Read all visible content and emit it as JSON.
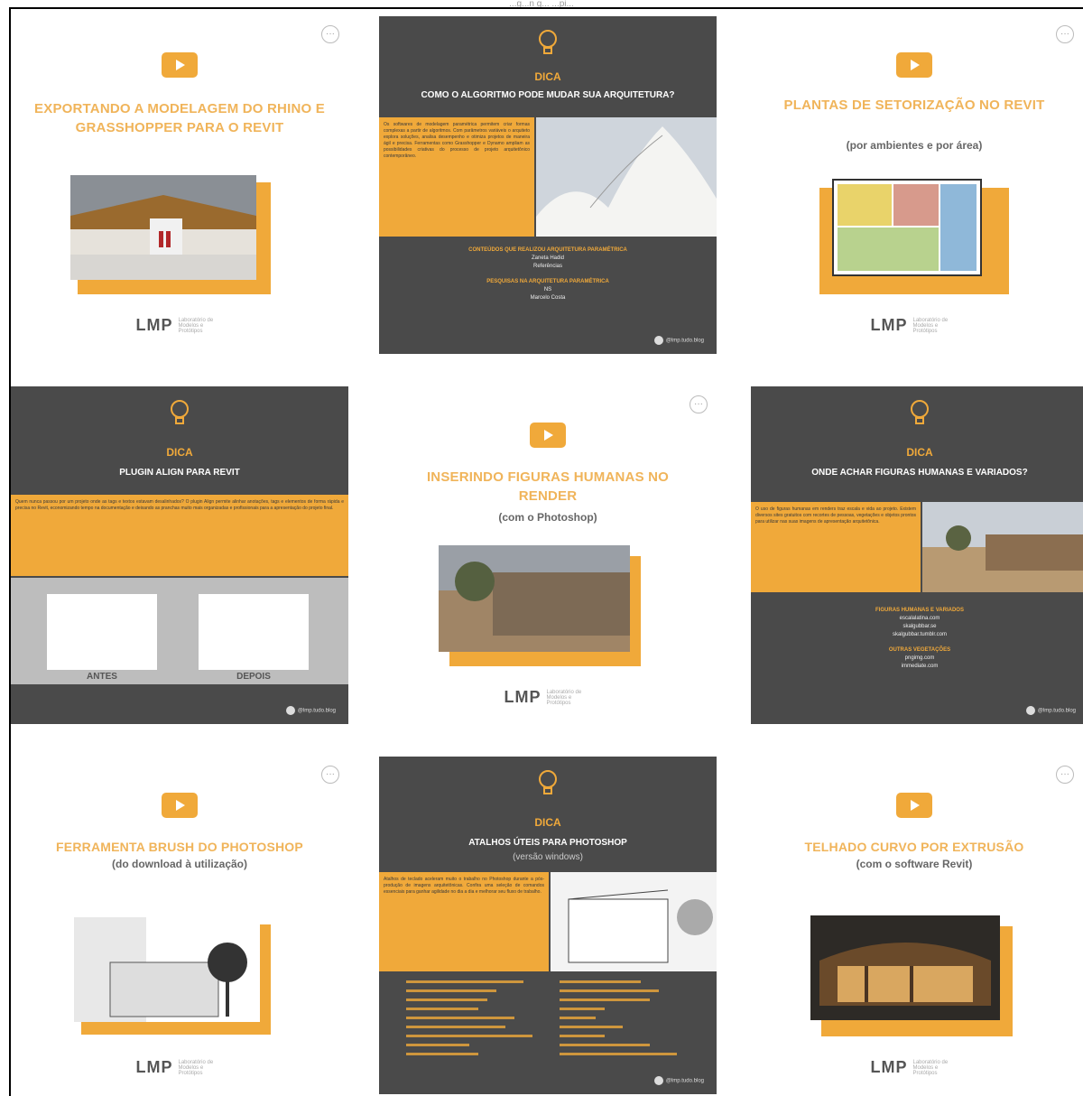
{
  "top": {
    "caption": "...g...n g... ...pi..."
  },
  "brand": {
    "logo": "LMP",
    "orange": "#f0a93a",
    "dark": "#4a4a4a",
    "handle": "@lmp.tudo.blog"
  },
  "tiles": [
    {
      "kind": "video",
      "title": "EXPORTANDO A MODELAGEM DO RHINO E GRASSHOPPER PARA O REVIT",
      "subtitle": ""
    },
    {
      "kind": "dica",
      "label": "DICA",
      "title": "COMO O ALGORITMO PODE MUDAR SUA ARQUITETURA?",
      "lines": [
        {
          "t": "o",
          "v": "CONTEÚDOS QUE REALIZOU ARQUITETURA PARAMÉTRICA"
        },
        {
          "t": "w",
          "v": "Zaneta Hadid"
        },
        {
          "t": "w",
          "v": "Referências"
        },
        {
          "t": "o",
          "v": "PESQUISAS NA ARQUITETURA PARAMÉTRICA"
        },
        {
          "t": "w",
          "v": "NS"
        },
        {
          "t": "w",
          "v": "Marcelo Costa"
        }
      ]
    },
    {
      "kind": "video",
      "title": "PLANTAS DE SETORIZAÇÃO NO REVIT",
      "subtitle": "(por ambientes e por área)"
    },
    {
      "kind": "dica",
      "label": "DICA",
      "title": "PLUGIN ALIGN PARA REVIT",
      "before": "ANTES",
      "after": "DEPOIS"
    },
    {
      "kind": "video",
      "title": "INSERINDO FIGURAS HUMANAS NO RENDER",
      "subtitle": "(com o Photoshop)"
    },
    {
      "kind": "dica",
      "label": "DICA",
      "title": "ONDE ACHAR FIGURAS HUMANAS E VARIADOS?",
      "lines": [
        {
          "t": "o",
          "v": "FIGURAS HUMANAS E VARIADOS"
        },
        {
          "t": "w",
          "v": "escalalatina.com"
        },
        {
          "t": "w",
          "v": "skalgubbar.se"
        },
        {
          "t": "w",
          "v": "skalgubbar.tumblr.com"
        },
        {
          "t": "o",
          "v": "OUTRAS VEGETAÇÕES"
        },
        {
          "t": "w",
          "v": "pngimg.com"
        },
        {
          "t": "w",
          "v": "immediate.com"
        }
      ]
    },
    {
      "kind": "video",
      "title": "FERRAMENTA BRUSH DO PHOTOSHOP",
      "subtitle": "(do download à utilização)"
    },
    {
      "kind": "dica",
      "label": "DICA",
      "title": "ATALHOS ÚTEIS PARA PHOTOSHOP",
      "subtitle": "(versão windows)"
    },
    {
      "kind": "video",
      "title": "TELHADO CURVO POR EXTRUSÃO",
      "subtitle": "(com o software Revit)"
    }
  ]
}
